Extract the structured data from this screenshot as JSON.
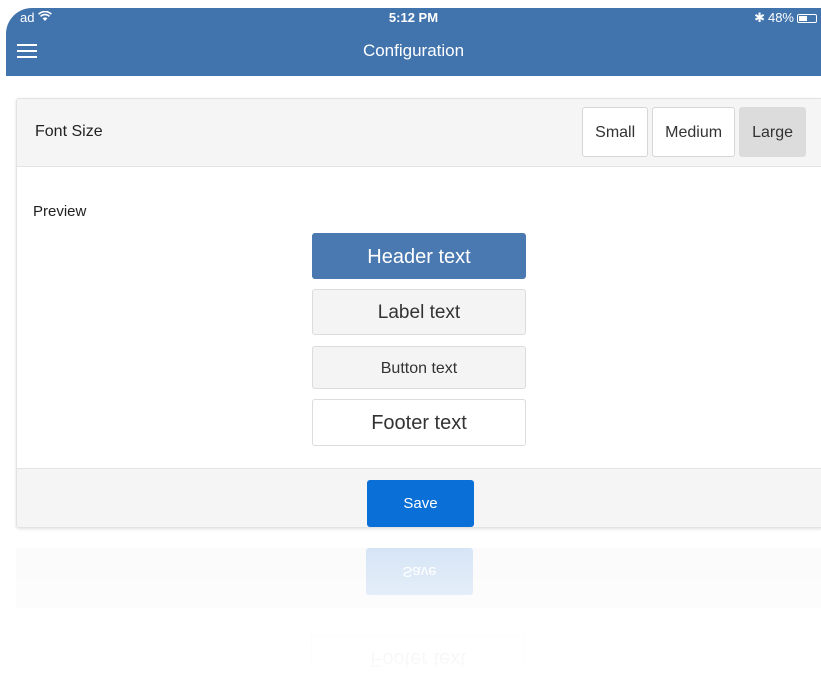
{
  "status_bar": {
    "carrier": "ad",
    "time": "5:12 PM",
    "bluetooth": "✱",
    "battery": "48%",
    "icons": [
      "wifi-icon",
      "bluetooth-icon",
      "battery-icon"
    ]
  },
  "navbar": {
    "title": "Configuration",
    "menu_icon": "hamburger-menu-icon"
  },
  "font_size": {
    "label": "Font Size",
    "options": [
      "Small",
      "Medium",
      "Large"
    ],
    "selected": "Large"
  },
  "preview": {
    "label": "Preview",
    "header": "Header text",
    "label_text": "Label text",
    "button_text": "Button text",
    "footer": "Footer text"
  },
  "footer": {
    "save_label": "Save"
  },
  "colors": {
    "nav_bar": "#4173ad",
    "header_preview": "#4a78b0",
    "save_button": "#0a6fd6",
    "selected_option": "#dcdcdc"
  }
}
